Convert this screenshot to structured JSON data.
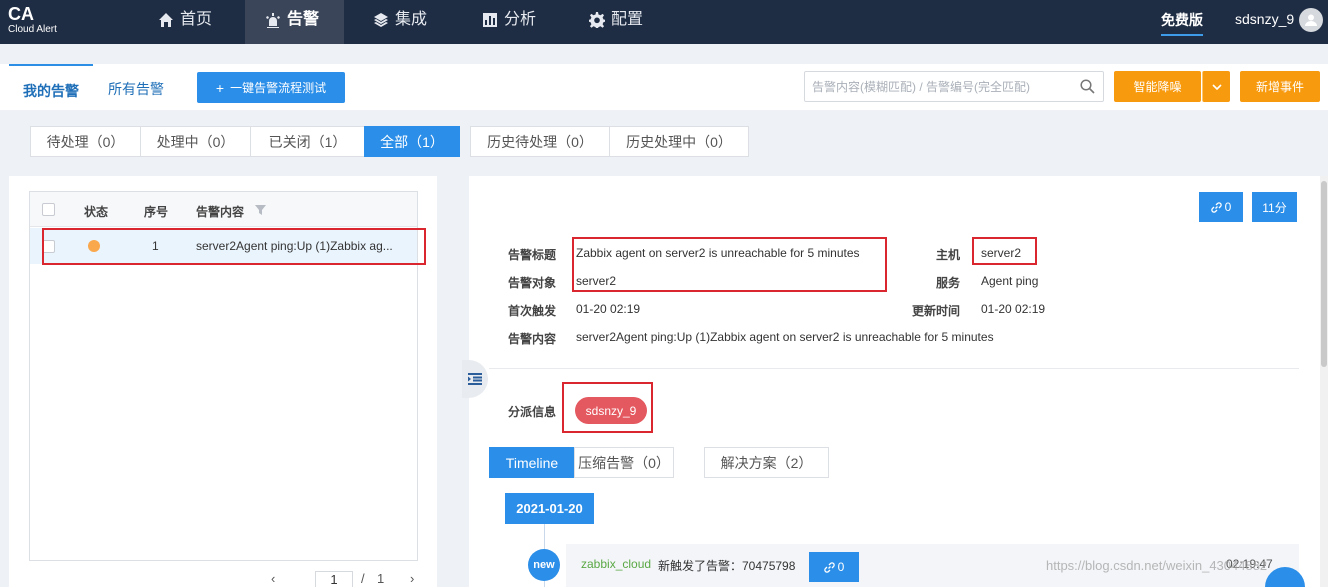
{
  "app": {
    "logo_big": "CA",
    "logo_small": "Cloud Alert"
  },
  "nav": {
    "items": [
      {
        "label": "首页",
        "icon": "home-icon"
      },
      {
        "label": "告警",
        "icon": "alarm-light-icon",
        "active": true
      },
      {
        "label": "集成",
        "icon": "layers-icon"
      },
      {
        "label": "分析",
        "icon": "bar-chart-icon"
      },
      {
        "label": "配置",
        "icon": "gear-icon"
      }
    ],
    "free_version": "免费版",
    "username": "sdsnzy_9"
  },
  "toolbar": {
    "tab_mine": "我的告警",
    "tab_all": "所有告警",
    "test_button": "一键告警流程测试",
    "search_placeholder": "告警内容(模糊匹配) / 告警编号(完全匹配)",
    "smart_noise": "智能降噪",
    "new_event": "新增事件"
  },
  "filters": [
    {
      "label": "待处理（0）"
    },
    {
      "label": "处理中（0）"
    },
    {
      "label": "已关闭（1）"
    },
    {
      "label": "全部（1）",
      "active": true
    },
    {
      "label": "历史待处理（0）"
    },
    {
      "label": "历史处理中（0）"
    }
  ],
  "alert_table": {
    "headers": {
      "status": "状态",
      "index": "序号",
      "content": "告警内容"
    },
    "rows": [
      {
        "status_color": "#f9a84d",
        "index": "1",
        "content": "server2Agent ping:Up (1)Zabbix ag..."
      }
    ],
    "pager": {
      "prev": "‹",
      "current": "1",
      "sep": "/",
      "total": "1",
      "next": "›"
    }
  },
  "detail": {
    "link_count": "0",
    "duration": "11分",
    "labels": {
      "title": "告警标题",
      "object": "告警对象",
      "first_trigger": "首次触发",
      "content": "告警内容",
      "host": "主机",
      "service": "服务",
      "update_time": "更新时间",
      "assign": "分派信息"
    },
    "values": {
      "title": "Zabbix agent on server2 is unreachable for 5 minutes",
      "object": "server2",
      "first_trigger": "01-20 02:19",
      "content": "server2Agent ping:Up (1)Zabbix agent on server2 is unreachable for 5 minutes",
      "host": "server2",
      "service": "Agent ping",
      "update_time": "01-20 02:19",
      "assignee": "sdsnzy_9"
    },
    "subtabs": [
      {
        "label": "Timeline",
        "active": true
      },
      {
        "label": "压缩告警（0）"
      },
      {
        "label": "解决方案（2）"
      }
    ],
    "timeline": {
      "date": "2021-01-20",
      "new_badge": "new",
      "user": "zabbix_cloud",
      "text": "新触发了告警：70475798",
      "link_count": "0",
      "time": "02:19:47"
    }
  },
  "watermark": "https://blog.csdn.net/weixin_43044882",
  "colors": {
    "nav_bg": "#1f2d44",
    "primary": "#2b8ee8",
    "orange": "#f79a0e",
    "highlight_red": "#d9262f",
    "assignee_pill": "#e4585f"
  }
}
